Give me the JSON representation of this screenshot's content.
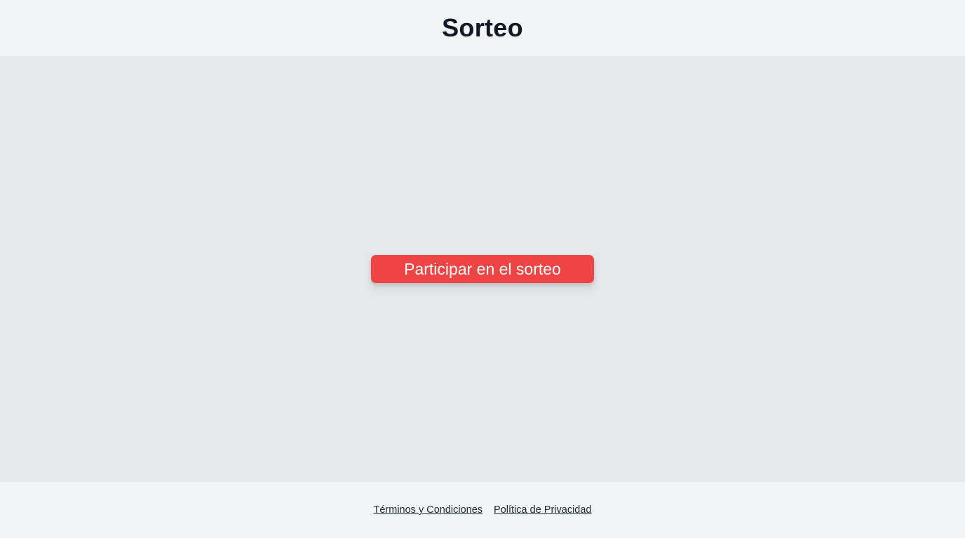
{
  "header": {
    "title": "Sorteo"
  },
  "main": {
    "cta_label": "Participar en el sorteo"
  },
  "footer": {
    "links": [
      {
        "label": "Términos y Condiciones"
      },
      {
        "label": "Política de Privacidad"
      }
    ]
  },
  "colors": {
    "header_bg": "#f3f4f6",
    "main_bg": "#e5e7eb",
    "accent": "#ef4444",
    "text": "#111827"
  }
}
